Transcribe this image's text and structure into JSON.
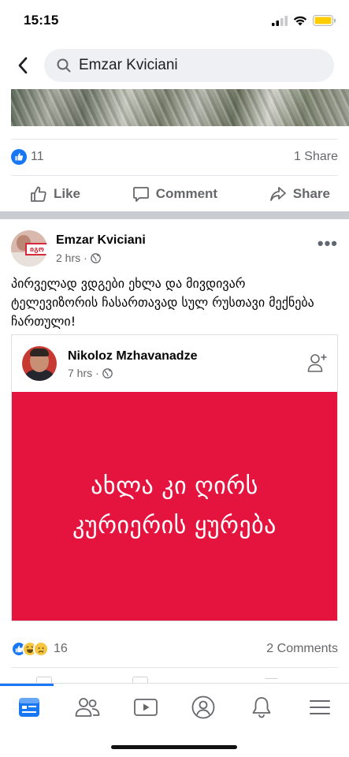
{
  "status": {
    "time": "15:15"
  },
  "search": {
    "query": "Emzar Kviciani"
  },
  "previous_post": {
    "reaction_count": "11",
    "shares": "1 Share"
  },
  "actions": {
    "like": "Like",
    "comment": "Comment",
    "share": "Share"
  },
  "post": {
    "author": "Emzar Kviciani",
    "time": "2 hrs",
    "text": "პირველად ვდგები ეხლა და მივდივარ ტელევიზორის ჩასართავად სულ რუსთავი მექნება ჩართული!",
    "avatar_sign": "იგო",
    "shared": {
      "author": "Nikoloz Mzhavanadze",
      "time": "7 hrs",
      "card_line1": "ახლა კი ღირს",
      "card_line2": "კურიერის ყურება",
      "card_color": "#e5143f"
    },
    "reaction_count": "16",
    "comments": "2 Comments"
  },
  "tabs": [
    "news-feed",
    "friends",
    "watch",
    "profile",
    "notifications",
    "menu"
  ],
  "colors": {
    "accent": "#1877f2",
    "secondary_text": "#65676b"
  }
}
